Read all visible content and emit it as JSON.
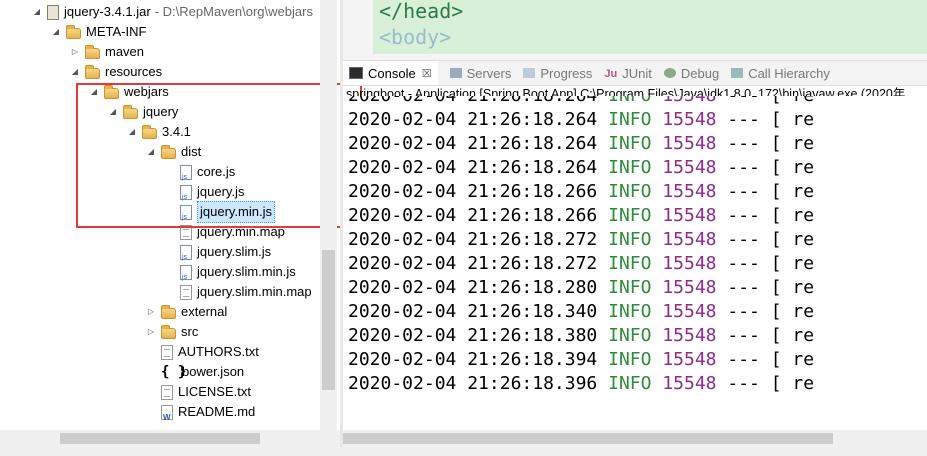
{
  "tree": [
    {
      "label": "jquery-3.4.1.jar",
      "path": "- D:\\RepMaven\\org\\webjars",
      "icon": "jar-icon",
      "arrow": "expanded",
      "level": 0
    },
    {
      "label": "META-INF",
      "icon": "folder-icon",
      "arrow": "expanded",
      "level": 1
    },
    {
      "label": "maven",
      "icon": "folder-icon",
      "arrow": "collapsed",
      "level": 2
    },
    {
      "label": "resources",
      "icon": "folder-icon",
      "arrow": "expanded",
      "level": 2
    },
    {
      "label": "webjars",
      "icon": "folder-icon",
      "arrow": "expanded",
      "level": 3
    },
    {
      "label": "jquery",
      "icon": "folder-icon",
      "arrow": "expanded",
      "level": 4
    },
    {
      "label": "3.4.1",
      "icon": "folder-icon",
      "arrow": "expanded",
      "level": 5
    },
    {
      "label": "dist",
      "icon": "folder-icon",
      "arrow": "expanded",
      "level": 6
    },
    {
      "label": "core.js",
      "icon": "js-file-icon",
      "arrow": "none",
      "level": 7
    },
    {
      "label": "jquery.js",
      "icon": "js-file-icon",
      "arrow": "none",
      "level": 7
    },
    {
      "label": "jquery.min.js",
      "icon": "js-file-icon",
      "arrow": "none",
      "level": 7,
      "selected": true
    },
    {
      "label": "jquery.min.map",
      "icon": "file-icon",
      "arrow": "none",
      "level": 7
    },
    {
      "label": "jquery.slim.js",
      "icon": "js-file-icon",
      "arrow": "none",
      "level": 7
    },
    {
      "label": "jquery.slim.min.js",
      "icon": "js-file-icon",
      "arrow": "none",
      "level": 7
    },
    {
      "label": "jquery.slim.min.map",
      "icon": "file-icon",
      "arrow": "none",
      "level": 7
    },
    {
      "label": "external",
      "icon": "folder-icon",
      "arrow": "collapsed",
      "level": 6
    },
    {
      "label": "src",
      "icon": "folder-icon",
      "arrow": "collapsed",
      "level": 6
    },
    {
      "label": "AUTHORS.txt",
      "icon": "text-file-icon",
      "arrow": "none",
      "level": 6
    },
    {
      "label": "bower.json",
      "icon": "json-file-icon",
      "arrow": "none",
      "level": 6
    },
    {
      "label": "LICENSE.txt",
      "icon": "text-file-icon",
      "arrow": "none",
      "level": 6
    },
    {
      "label": "README.md",
      "icon": "markdown-file-icon",
      "arrow": "none",
      "level": 6
    }
  ],
  "editor": {
    "line1": "</head>",
    "line2": "<body>"
  },
  "tabs": [
    {
      "label": "Console",
      "icon": "console-icon",
      "active": true,
      "close": "☒"
    },
    {
      "label": "Servers",
      "icon": "servers-icon"
    },
    {
      "label": "Progress",
      "icon": "progress-icon"
    },
    {
      "label": "JUnit",
      "icon": "junit-icon"
    },
    {
      "label": "Debug",
      "icon": "debug-icon"
    },
    {
      "label": "Call Hierarchy",
      "icon": "call-hierarchy-icon"
    }
  ],
  "console": {
    "header": "springboot - Application [Spring Boot App] C:\\Program Files\\Java\\jdk1.8.0_172\\bin\\javaw.exe (2020年",
    "lines": [
      {
        "date": "2020-02-04",
        "time": "21:26:18.264",
        "level": "INFO",
        "pid": "15548",
        "sep": "---",
        "rest": "[  re"
      },
      {
        "date": "2020-02-04",
        "time": "21:26:18.264",
        "level": "INFO",
        "pid": "15548",
        "sep": "---",
        "rest": "[  re"
      },
      {
        "date": "2020-02-04",
        "time": "21:26:18.264",
        "level": "INFO",
        "pid": "15548",
        "sep": "---",
        "rest": "[  re"
      },
      {
        "date": "2020-02-04",
        "time": "21:26:18.264",
        "level": "INFO",
        "pid": "15548",
        "sep": "---",
        "rest": "[  re"
      },
      {
        "date": "2020-02-04",
        "time": "21:26:18.266",
        "level": "INFO",
        "pid": "15548",
        "sep": "---",
        "rest": "[  re"
      },
      {
        "date": "2020-02-04",
        "time": "21:26:18.266",
        "level": "INFO",
        "pid": "15548",
        "sep": "---",
        "rest": "[  re"
      },
      {
        "date": "2020-02-04",
        "time": "21:26:18.272",
        "level": "INFO",
        "pid": "15548",
        "sep": "---",
        "rest": "[  re"
      },
      {
        "date": "2020-02-04",
        "time": "21:26:18.272",
        "level": "INFO",
        "pid": "15548",
        "sep": "---",
        "rest": "[  re"
      },
      {
        "date": "2020-02-04",
        "time": "21:26:18.280",
        "level": "INFO",
        "pid": "15548",
        "sep": "---",
        "rest": "[  re"
      },
      {
        "date": "2020-02-04",
        "time": "21:26:18.340",
        "level": "INFO",
        "pid": "15548",
        "sep": "---",
        "rest": "[  re"
      },
      {
        "date": "2020-02-04",
        "time": "21:26:18.380",
        "level": "INFO",
        "pid": "15548",
        "sep": "---",
        "rest": "[  re"
      },
      {
        "date": "2020-02-04",
        "time": "21:26:18.394",
        "level": "INFO",
        "pid": "15548",
        "sep": "---",
        "rest": "[  re"
      },
      {
        "date": "2020-02-04",
        "time": "21:26:18.396",
        "level": "INFO",
        "pid": "15548",
        "sep": "---",
        "rest": "[  re"
      }
    ]
  },
  "colors": {
    "highlight_box": "#e53935",
    "selection": "#cce8ff",
    "info": "#2e8b3a",
    "pid": "#8a2a8a"
  }
}
